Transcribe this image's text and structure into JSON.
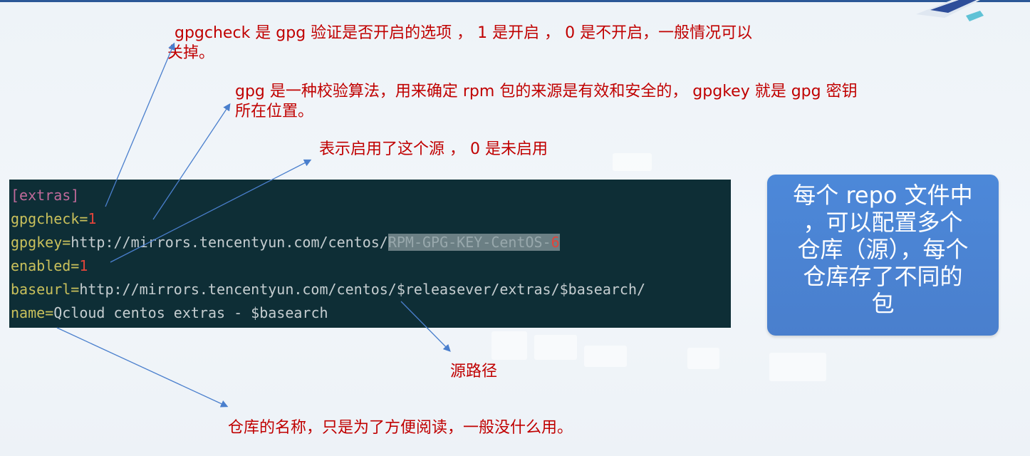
{
  "annotations": {
    "gpgcheck_note_line1": "gpgcheck 是 gpg 验证是否开启的选项 ， 1 是开启 ， 0 是不开启，一般情况可以",
    "gpgcheck_note_line2": "关掉。",
    "gpgkey_note_line1": "gpg 是一种校验算法，用来确定 rpm 包的来源是有效和安全的， gpgkey 就是 gpg 密钥",
    "gpgkey_note_line2": "所在位置。",
    "enabled_note": "表示启用了这个源 ， 0 是未启用",
    "baseurl_note": "源路径",
    "name_note": "仓库的名称，只是为了方便阅读，一般没什么用。"
  },
  "terminal": {
    "section": "[extras]",
    "gpgcheck_key": "gpgcheck=",
    "gpgcheck_value": "1",
    "gpgkey_key": "gpgkey=",
    "gpgkey_url": "http://mirrors.tencentyun.com/centos/",
    "gpgkey_file": "RPM-GPG-KEY-CentOS-",
    "gpgkey_file_version": "6",
    "enabled_key": "enabled=",
    "enabled_value": "1",
    "baseurl_key": "baseurl=",
    "baseurl_value": "http://mirrors.tencentyun.com/centos/$releasever/extras/$basearch/",
    "name_key": "name=",
    "name_value": "Qcloud centos extras - $basearch"
  },
  "callout": {
    "line1": "每个 repo 文件中",
    "line2": "，可以配置多个",
    "line3": "仓库（源），每个",
    "line4": "仓库存了不同的",
    "line5": "包"
  },
  "colors": {
    "annotation_text": "#c00000",
    "arrow": "#4a7fcd",
    "terminal_bg": "#0e2e36",
    "key_color": "#c9c05b",
    "value_red": "#e2443a",
    "callout_bg": "#4c88d9"
  }
}
